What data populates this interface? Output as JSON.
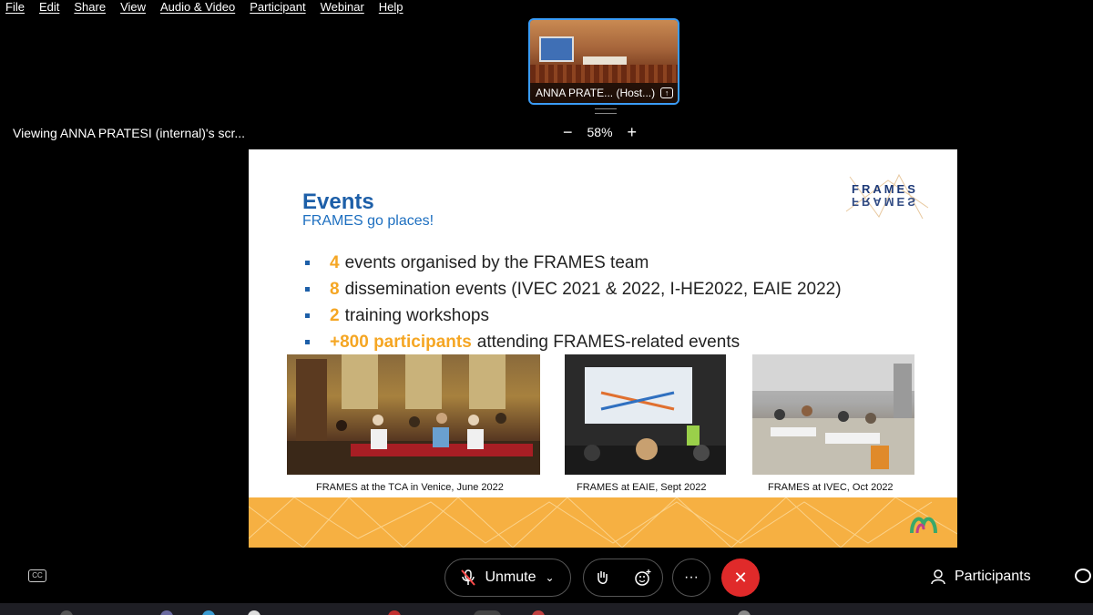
{
  "menu": [
    "File",
    "Edit",
    "Share",
    "View",
    "Audio & Video",
    "Participant",
    "Webinar",
    "Help"
  ],
  "thumbnail": {
    "label": "ANNA PRATE... (Host...)"
  },
  "viewing_text": "Viewing ANNA PRATESI (internal)'s scr...",
  "zoom": {
    "minus": "−",
    "level": "58%",
    "plus": "+"
  },
  "slide": {
    "title": "Events",
    "subtitle": "FRAMES go places!",
    "logo_text": "FRAMES",
    "bullets": [
      {
        "num": "4",
        "text": "events organised by the FRAMES team"
      },
      {
        "num": "8",
        "text": "dissemination events (IVEC 2021 & 2022, I-HE2022, EAIE 2022)"
      },
      {
        "num": "2",
        "text": "training workshops"
      },
      {
        "num": "+800 participants",
        "text": "attending FRAMES-related events"
      }
    ],
    "captions": [
      "FRAMES at the TCA in Venice, June 2022",
      "FRAMES at EAIE, Sept  2022",
      "FRAMES at IVEC, Oct 2022"
    ]
  },
  "controls": {
    "cc": "CC",
    "unmute": "Unmute",
    "more": "···",
    "end": "✕",
    "participants": "Participants"
  },
  "colors": {
    "accent_blue": "#1d5fa8",
    "accent_orange": "#f5a623",
    "end_red": "#e02a2a",
    "thumb_border": "#3b9cf5"
  }
}
